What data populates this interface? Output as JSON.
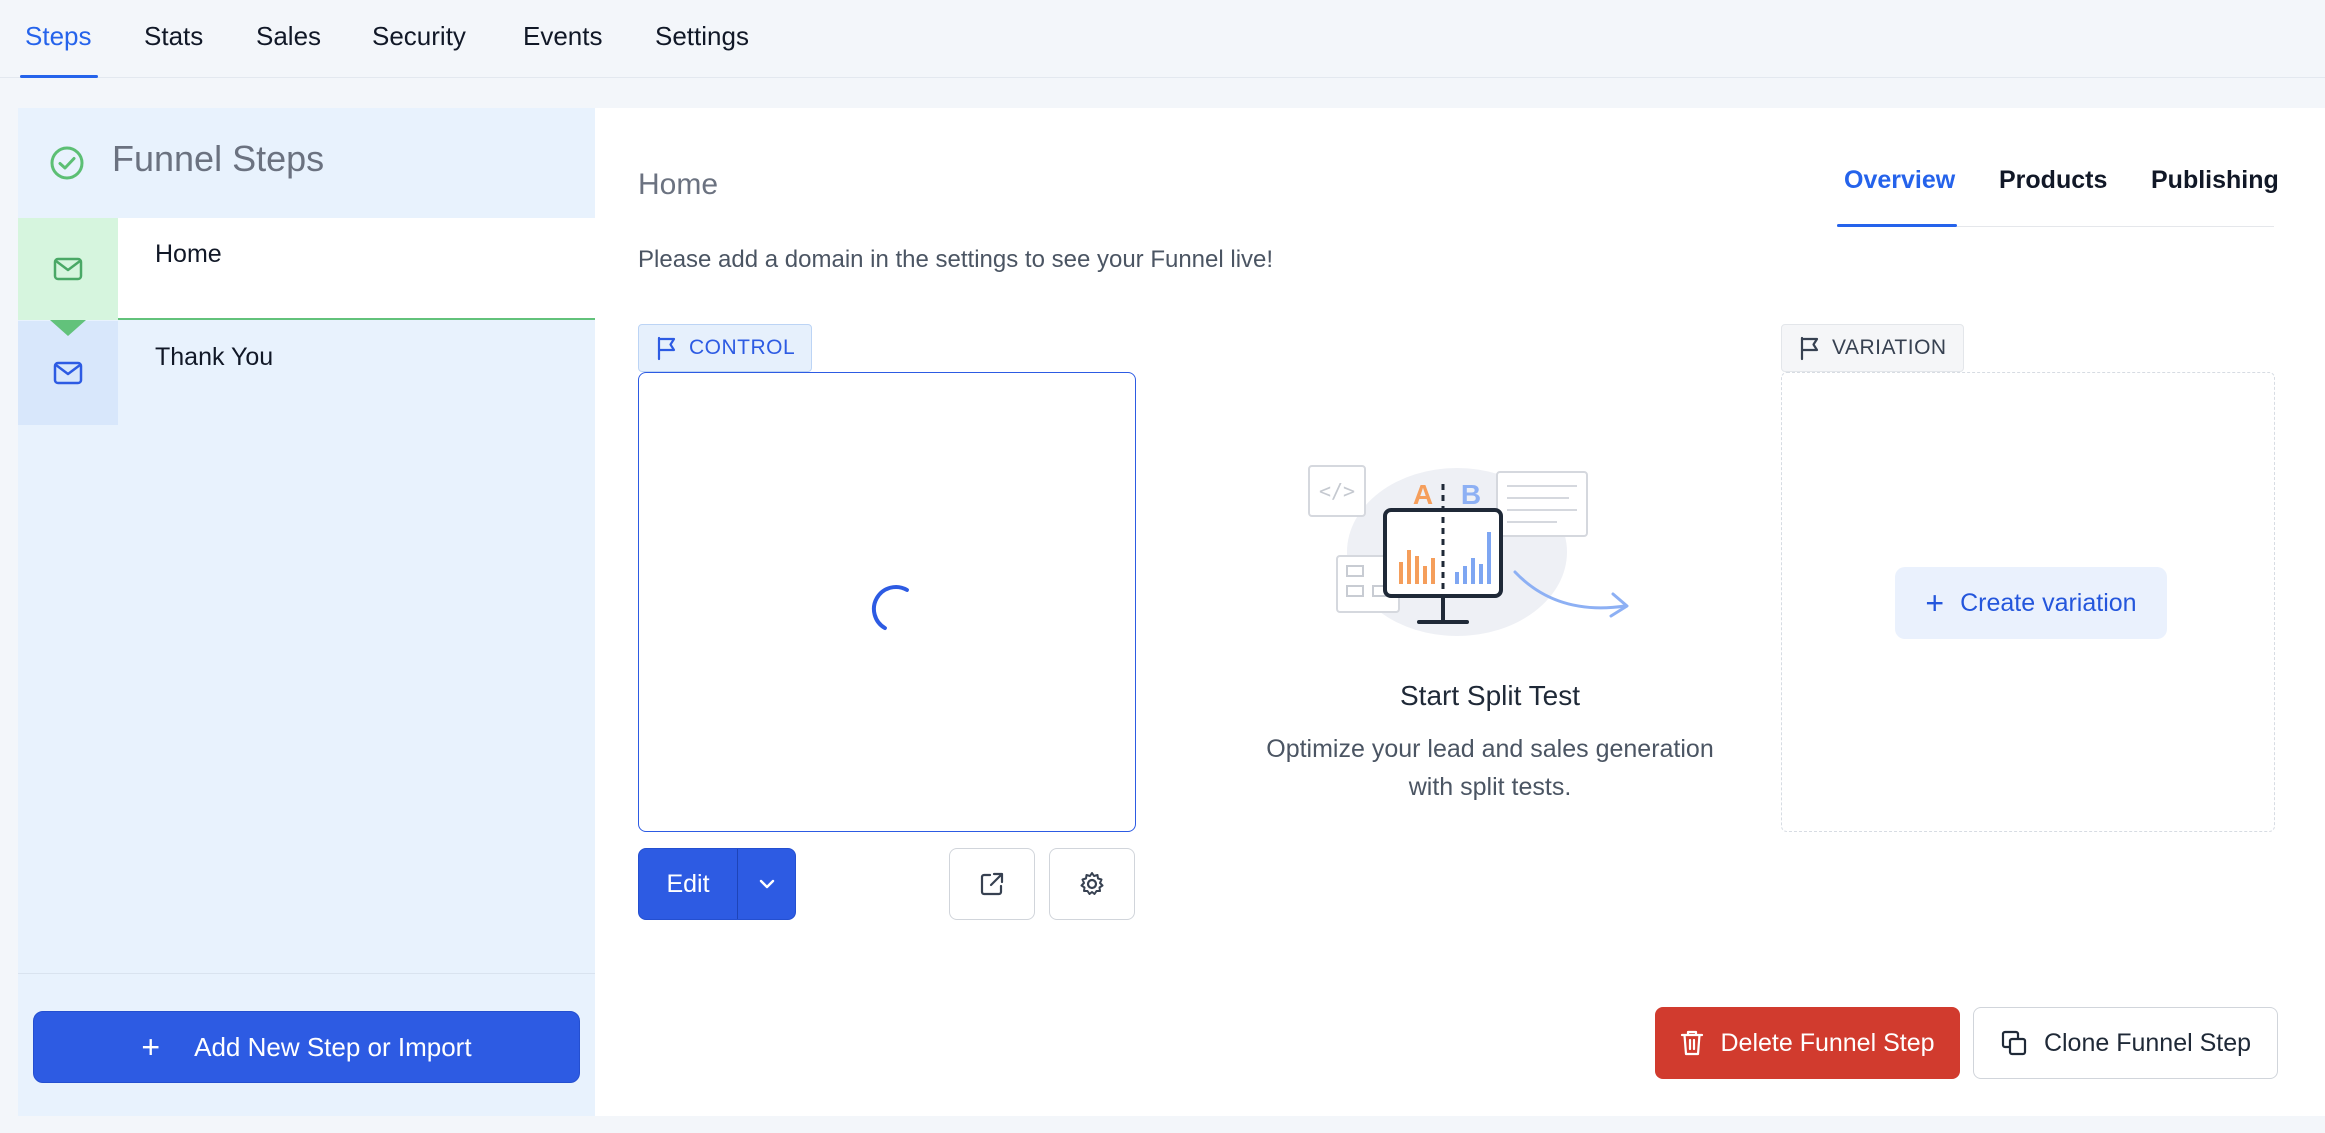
{
  "topnav": {
    "tabs": [
      {
        "label": "Steps"
      },
      {
        "label": "Stats"
      },
      {
        "label": "Sales"
      },
      {
        "label": "Security"
      },
      {
        "label": "Events"
      },
      {
        "label": "Settings"
      }
    ],
    "active": "Steps"
  },
  "sidebar": {
    "title": "Funnel Steps",
    "steps": [
      {
        "label": "Home",
        "icon": "mail-icon",
        "selected": true
      },
      {
        "label": "Thank You",
        "icon": "mail-icon",
        "selected": false
      }
    ],
    "add_button": "Add New Step or Import"
  },
  "main": {
    "page_title": "Home",
    "subtabs": [
      {
        "label": "Overview"
      },
      {
        "label": "Products"
      },
      {
        "label": "Publishing"
      }
    ],
    "active_subtab": "Overview",
    "notice": "Please add a domain in the settings to see your Funnel live!",
    "control_label": "CONTROL",
    "variation_label": "VARIATION",
    "edit_button": "Edit",
    "split_test": {
      "title": "Start Split Test",
      "description_line1": "Optimize your lead and sales generation",
      "description_line2": "with split tests.",
      "label_a": "A",
      "label_b": "B"
    },
    "create_variation": "Create variation",
    "delete_button": "Delete Funnel Step",
    "clone_button": "Clone Funnel Step"
  },
  "colors": {
    "primary": "#2d5be3",
    "danger": "#d13b2e",
    "success": "#62c27b",
    "sidebar_bg": "#e8f2fd"
  }
}
